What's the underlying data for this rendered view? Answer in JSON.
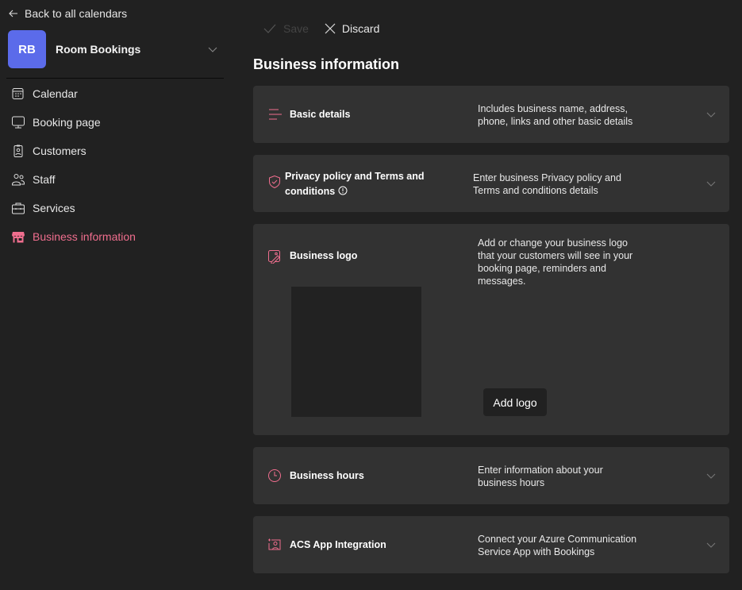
{
  "sidebar": {
    "back_label": "Back to all calendars",
    "calendar": {
      "initials": "RB",
      "name": "Room Bookings",
      "avatar_color": "#5b6bea"
    },
    "items": [
      {
        "label": "Calendar",
        "icon": "calendar-icon",
        "active": false
      },
      {
        "label": "Booking page",
        "icon": "monitor-icon",
        "active": false
      },
      {
        "label": "Customers",
        "icon": "contact-card-icon",
        "active": false
      },
      {
        "label": "Staff",
        "icon": "people-icon",
        "active": false
      },
      {
        "label": "Services",
        "icon": "briefcase-icon",
        "active": true
      },
      {
        "label": "Business information",
        "icon": "storefront-icon",
        "active": true
      }
    ],
    "accent_color": "#f06e8e"
  },
  "toolbar": {
    "save_label": "Save",
    "discard_label": "Discard"
  },
  "main": {
    "title": "Business information",
    "sections": [
      {
        "title": "Basic details",
        "icon": "text-align-icon",
        "description": "Includes business name, address, phone, links and other basic details"
      },
      {
        "title": "Privacy policy and Terms and conditions",
        "icon": "shield-check-icon",
        "description": "Enter business Privacy policy and Terms and conditions details"
      },
      {
        "title": "Business logo",
        "icon": "image-edit-icon",
        "description": "Add or change your business logo that your customers will see in your booking page, reminders and messages.",
        "button": "Add logo"
      },
      {
        "title": "Business hours",
        "icon": "clock-icon",
        "description": "Enter information about your business hours"
      },
      {
        "title": "ACS App Integration",
        "icon": "person-screen-icon",
        "description": "Connect your Azure Communication Service App with Bookings"
      }
    ]
  }
}
